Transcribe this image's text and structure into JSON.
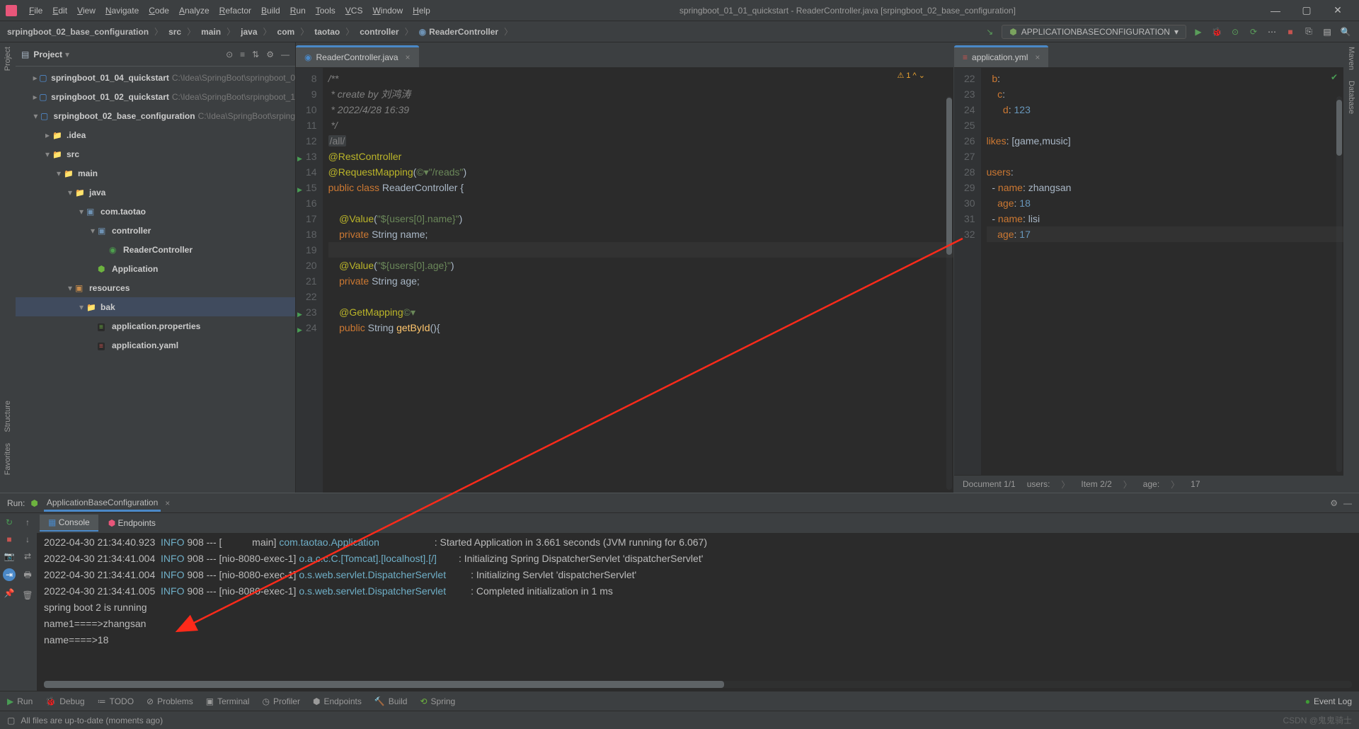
{
  "menu": {
    "items": [
      "File",
      "Edit",
      "View",
      "Navigate",
      "Code",
      "Analyze",
      "Refactor",
      "Build",
      "Run",
      "Tools",
      "VCS",
      "Window",
      "Help"
    ],
    "title": "springboot_01_01_quickstart - ReaderController.java [srpingboot_02_base_configuration]"
  },
  "breadcrumbs": [
    "srpingboot_02_base_configuration",
    "src",
    "main",
    "java",
    "com",
    "taotao",
    "controller",
    "ReaderController"
  ],
  "runConfig": "APPLICATIONBASECONFIGURATION",
  "projectPanel": {
    "title": "Project",
    "rows": [
      {
        "indent": 1,
        "arrow": "▸",
        "icon": "mod",
        "label": "springboot_01_04_quickstart",
        "path": "C:\\Idea\\SpringBoot\\springboot_0"
      },
      {
        "indent": 1,
        "arrow": "▸",
        "icon": "mod",
        "label": "srpingboot_01_02_quickstart",
        "path": "C:\\Idea\\SpringBoot\\srpingboot_1"
      },
      {
        "indent": 1,
        "arrow": "▾",
        "icon": "mod",
        "label": "srpingboot_02_base_configuration",
        "path": "C:\\Idea\\SpringBoot\\srping"
      },
      {
        "indent": 2,
        "arrow": "▸",
        "icon": "dir",
        "label": ".idea"
      },
      {
        "indent": 2,
        "arrow": "▾",
        "icon": "dir",
        "label": "src"
      },
      {
        "indent": 3,
        "arrow": "▾",
        "icon": "dir",
        "label": "main"
      },
      {
        "indent": 4,
        "arrow": "▾",
        "icon": "dir",
        "label": "java"
      },
      {
        "indent": 5,
        "arrow": "▾",
        "icon": "pkg",
        "label": "com.taotao"
      },
      {
        "indent": 6,
        "arrow": "▾",
        "icon": "pkg",
        "label": "controller"
      },
      {
        "indent": 7,
        "arrow": " ",
        "icon": "cls",
        "label": "ReaderController"
      },
      {
        "indent": 6,
        "arrow": " ",
        "icon": "spr",
        "label": "Application"
      },
      {
        "indent": 4,
        "arrow": "▾",
        "icon": "res",
        "label": "resources"
      },
      {
        "indent": 5,
        "arrow": "▾",
        "icon": "dir",
        "label": "bak",
        "sel": true
      },
      {
        "indent": 6,
        "arrow": " ",
        "icon": "prop",
        "label": "application.properties"
      },
      {
        "indent": 6,
        "arrow": " ",
        "icon": "yml",
        "label": "application.yaml"
      }
    ]
  },
  "leftTabs": [
    "Project"
  ],
  "leftTabsBottom": [
    "Structure",
    "Favorites"
  ],
  "rightTabs": [
    "Maven",
    "Database"
  ],
  "editor1": {
    "tab": "ReaderController.java",
    "warn": "⚠ 1  ^  ⌄",
    "lines": [
      {
        "n": 8,
        "html": "<span class='c-comment'>/**</span>"
      },
      {
        "n": 9,
        "html": "<span class='c-comment'> * create by 刘鸿涛</span>"
      },
      {
        "n": 10,
        "html": "<span class='c-comment'> * 2022/4/28 16:39</span>"
      },
      {
        "n": 11,
        "html": "<span class='c-comment'> */</span>"
      },
      {
        "n": 12,
        "html": "<span class='fold'>/all/</span>"
      },
      {
        "n": 13,
        "run": true,
        "html": "<span class='c-anno'>@RestController</span>"
      },
      {
        "n": 14,
        "html": "<span class='c-anno'>@RequestMapping</span>(<span class='c-str'>©▾\"/reads\"</span>)"
      },
      {
        "n": 15,
        "run": true,
        "html": "<span class='c-kw'>public class</span> <span class='c-type'>ReaderController</span> {"
      },
      {
        "n": 16,
        "html": ""
      },
      {
        "n": 17,
        "html": "    <span class='c-anno'>@Value</span>(<span class='c-str'>\"${users[0].name}\"</span>)"
      },
      {
        "n": 18,
        "html": "    <span class='c-kw'>private</span> <span class='c-type'>String</span> name;"
      },
      {
        "n": 19,
        "html": "",
        "cur": true
      },
      {
        "n": 20,
        "html": "    <span class='c-anno'>@Value</span>(<span class='c-str'>\"${users[0].age}\"</span>)"
      },
      {
        "n": 21,
        "html": "    <span class='c-kw'>private</span> <span class='c-type'>String</span> age;"
      },
      {
        "n": 22,
        "html": ""
      },
      {
        "n": 23,
        "run": true,
        "html": "    <span class='c-anno'>@GetMapping</span><span class='c-str'>©▾</span>"
      },
      {
        "n": 24,
        "run": true,
        "html": "    <span class='c-kw'>public</span> <span class='c-type'>String</span> <span class='c-method'>getById</span>(){"
      }
    ]
  },
  "editor2": {
    "tab": "application.yml",
    "lines": [
      {
        "n": 22,
        "html": "  <span class='c-ykey'>b</span>:"
      },
      {
        "n": 23,
        "html": "    <span class='c-ykey'>c</span>:"
      },
      {
        "n": 24,
        "html": "      <span class='c-ykey'>d</span>: <span class='c-ynum'>123</span>"
      },
      {
        "n": 25,
        "html": ""
      },
      {
        "n": 26,
        "html": "<span class='c-ykey'>likes</span>: <span class='c-ybr'>[</span><span class='c-yval'>game</span>,<span class='c-yval'>music</span><span class='c-ybr'>]</span>"
      },
      {
        "n": 27,
        "html": ""
      },
      {
        "n": 28,
        "html": "<span class='c-ykey'>users</span>:"
      },
      {
        "n": 29,
        "html": "  - <span class='c-ykey'>name</span>: <span class='c-yval'>zhangsan</span>"
      },
      {
        "n": 30,
        "html": "    <span class='c-ykey'>age</span>: <span class='c-ynum'>18</span>"
      },
      {
        "n": 31,
        "html": "  - <span class='c-ykey'>name</span>: <span class='c-yval'>lisi</span>"
      },
      {
        "n": 32,
        "html": "    <span class='c-ykey'>age</span>: <span class='c-ynum'>17</span>",
        "cur": true
      }
    ],
    "status": {
      "doc": "Document 1/1",
      "p1": "users:",
      "p2": "Item 2/2",
      "p3": "age:",
      "p4": "17"
    }
  },
  "runPanel": {
    "title": "Run:",
    "tab": "ApplicationBaseConfiguration",
    "consoleTabs": [
      "Console",
      "Endpoints"
    ],
    "lines": [
      {
        "ts": "2022-04-30 21:34:40.923",
        "lvl": "INFO",
        "pid": "908",
        "thread": "[           main]",
        "cls": "com.taotao.Application",
        "msg": ": Started Application in 3.661 seconds (JVM running for 6.067)"
      },
      {
        "ts": "2022-04-30 21:34:41.004",
        "lvl": "INFO",
        "pid": "908",
        "thread": "[nio-8080-exec-1]",
        "cls": "o.a.c.c.C.[Tomcat].[localhost].[/]",
        "msg": ": Initializing Spring DispatcherServlet 'dispatcherServlet'"
      },
      {
        "ts": "2022-04-30 21:34:41.004",
        "lvl": "INFO",
        "pid": "908",
        "thread": "[nio-8080-exec-1]",
        "cls": "o.s.web.servlet.DispatcherServlet",
        "msg": ": Initializing Servlet 'dispatcherServlet'"
      },
      {
        "ts": "2022-04-30 21:34:41.005",
        "lvl": "INFO",
        "pid": "908",
        "thread": "[nio-8080-exec-1]",
        "cls": "o.s.web.servlet.DispatcherServlet",
        "msg": ": Completed initialization in 1 ms"
      }
    ],
    "plain": [
      "spring boot 2 is running",
      "name1====>zhangsan",
      "name====>18"
    ]
  },
  "bottomTools": [
    "Run",
    "Debug",
    "TODO",
    "Problems",
    "Terminal",
    "Profiler",
    "Endpoints",
    "Build",
    "Spring"
  ],
  "eventLog": "Event Log",
  "footer": {
    "msg": "All files are up-to-date (moments ago)"
  },
  "watermark": "CSDN @鬼鬼骑士"
}
